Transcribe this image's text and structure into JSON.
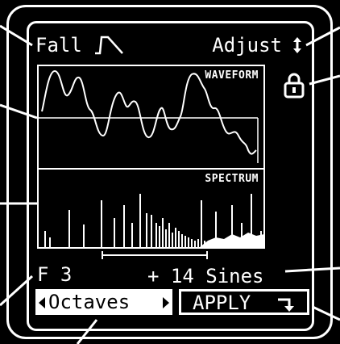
{
  "header": {
    "mode_label": "Fall",
    "mode_icon": "fall-shape-icon",
    "adjust_label": "Adjust",
    "adjust_icon": "up-down-arrow-icon",
    "lock_icon": "padlock-icon"
  },
  "waveform": {
    "label": "WAVEFORM"
  },
  "spectrum": {
    "label": "SPECTRUM"
  },
  "footer": {
    "note": "F 3",
    "sines": "+ 14 Sines",
    "octaves_label": "Octaves",
    "apply_label": "APPLY",
    "apply_icon": "enter-arrow-icon"
  },
  "colors": {
    "background": "#000000",
    "foreground": "#ffffff"
  }
}
